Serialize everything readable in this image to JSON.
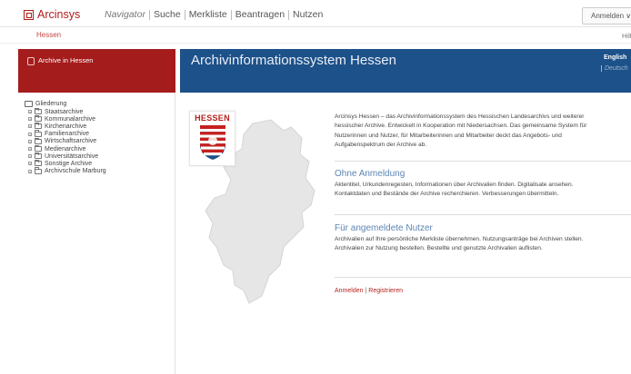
{
  "app": {
    "name": "Arcinsys",
    "region": "Hessen"
  },
  "nav": {
    "items": [
      "Navigator",
      "Suche",
      "Merkliste",
      "Beantragen",
      "Nutzen"
    ]
  },
  "header": {
    "login": "Anmelden ∨",
    "help": "Hilf"
  },
  "sidebar": {
    "title": "Archive in Hessen",
    "tree_root": "Gliederung",
    "items": [
      "Staatsarchive",
      "Kommunalarchive",
      "Kirchenarchive",
      "Familienarchive",
      "Wirtschaftsarchive",
      "Medienarchive",
      "Universitätsarchive",
      "Sonstige Archive",
      "Archivschule Marburg"
    ]
  },
  "main": {
    "title": "Archivinformationssystem Hessen",
    "lang_en": "English",
    "lang_de": "Deutsch",
    "coat_label": "HESSEN",
    "intro": "Arcinsys Hessen – das Archivinformationssystem des Hessischen Landesarchivs und weiterer hessischer Archive. Entwickelt in Kooperation mit Niedersachsen. Das gemeinsame System für Nutzerinnen und Nutzer, für Mitarbeiterinnen und Mitarbeiter deckt das Angebots- und Aufgabenspektrum der Archive ab.",
    "section1_title": "Ohne Anmeldung",
    "section1_text": "Aktentitel, Urkundenregesten, Informationen über Archivalien finden. Digitalisate ansehen. Kontaktdaten und Bestände der Archive recherchieren. Verbesserungen übermitteln.",
    "section2_title": "Für angemeldete Nutzer",
    "section2_text": "Archivalien auf Ihre persönliche Merkliste übernehmen. Nutzungsanträge bei Archiven stellen. Archivalien zur Nutzung bestellen. Bestellte und genutzte Archivalien auflisten.",
    "link_login": "Anmelden",
    "link_sep": "|",
    "link_register": "Registrieren"
  },
  "colors": {
    "brand_red": "#a51c1c",
    "header_blue": "#1d5189",
    "section_blue": "#5d85b3"
  }
}
